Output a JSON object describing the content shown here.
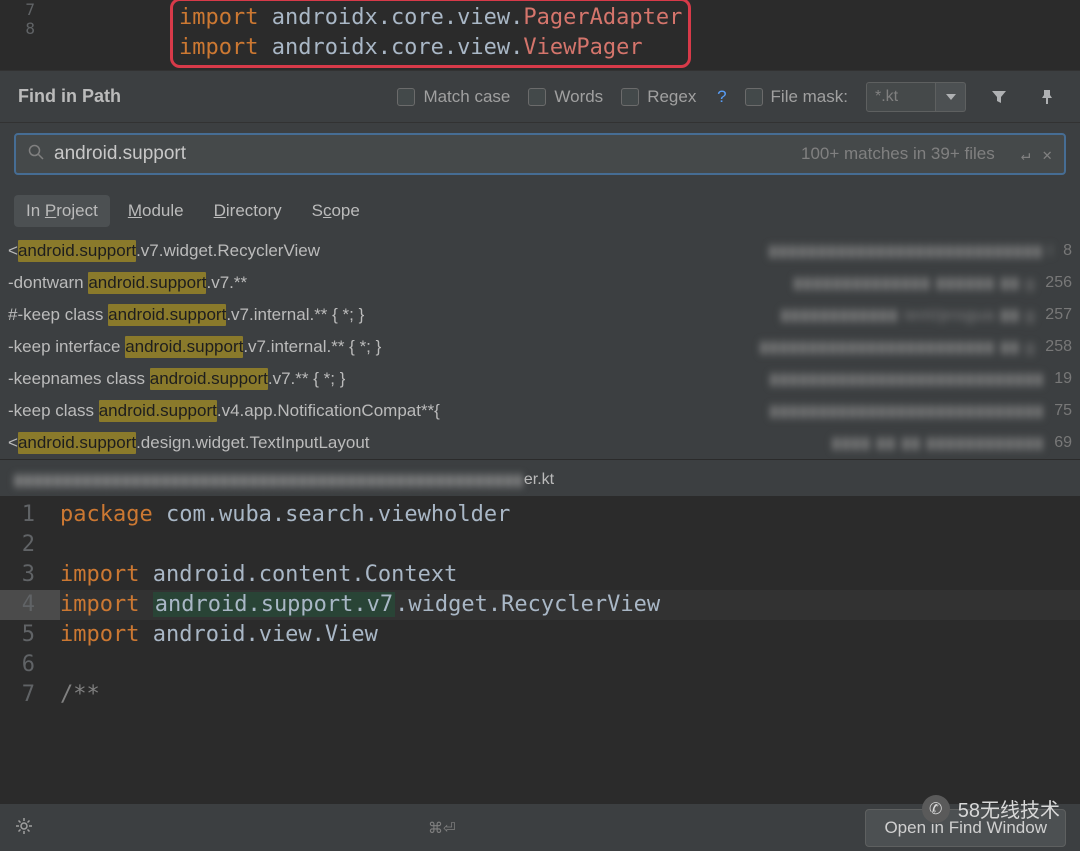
{
  "topCode": [
    {
      "num": "7",
      "kw": "import",
      "pkg": "androidx.core.view.",
      "err": "PagerAdapter"
    },
    {
      "num": "8",
      "kw": "import",
      "pkg": "androidx.core.view.",
      "err": "ViewPager"
    }
  ],
  "find": {
    "title": "Find in Path",
    "matchCase": "Match case",
    "words": "Words",
    "regex": "Regex",
    "regexQ": "?",
    "fileMask": "File mask:",
    "fileMaskVal": "*.kt"
  },
  "search": {
    "value": "android.support",
    "matches": "100+ matches in 39+ files"
  },
  "tabs": {
    "project": "In Project",
    "module": "Module",
    "directory": "Directory",
    "scope": "Scope"
  },
  "results": [
    {
      "pre": "<",
      "hl": "android.support",
      "post": ".v7.widget.RecyclerView",
      "line": "8"
    },
    {
      "pre": "-dontwarn ",
      "hl": "android.support",
      "post": ".v7.**",
      "line": "256"
    },
    {
      "pre": "#-keep class ",
      "hl": "android.support",
      "post": ".v7.internal.** { *; }",
      "line": "257"
    },
    {
      "pre": "-keep interface ",
      "hl": "android.support",
      "post": ".v7.internal.** { *; }",
      "line": "258"
    },
    {
      "pre": "-keepnames class ",
      "hl": "android.support",
      "post": ".v7.** { *; }",
      "line": "19"
    },
    {
      "pre": "-keep class ",
      "hl": "android.support",
      "post": ".v4.app.NotificationCompat**{",
      "line": "75"
    },
    {
      "pre": "<",
      "hl": "android.support",
      "post": ".design.widget.TextInputLayout",
      "line": "69"
    }
  ],
  "resultFiles": [
    "▮▮▮▮▮▮▮▮▮▮▮▮▮▮▮▮▮▮▮▮▮▮▮▮▮▮▮▮ l",
    "▮▮▮▮▮▮▮▮▮▮▮▮▮▮ ▮▮▮▮▮▮ ▮▮ g",
    "▮▮▮▮▮▮▮▮▮▮▮▮ ient/progua ▮▮ g",
    "▮▮▮▮▮▮▮▮▮▮▮▮▮▮▮▮▮▮▮▮▮▮▮▮ ▮▮ g",
    "▮▮▮▮▮▮▮▮▮▮▮▮▮▮▮▮▮▮▮▮▮▮▮▮▮▮▮▮",
    "▮▮▮▮▮▮▮▮▮▮▮▮▮▮▮▮▮▮▮▮▮▮▮▮▮▮▮▮",
    "▮▮▮▮ ▮▮ ▮▮ ▮▮▮▮▮▮▮▮▮▮▮▮"
  ],
  "preview": {
    "ext": "er.kt",
    "lines": [
      {
        "num": "1",
        "html": "<span class='kw'>package</span> <span class='pkg'>com.wuba.search.viewholder</span>"
      },
      {
        "num": "2",
        "html": ""
      },
      {
        "num": "3",
        "html": "<span class='kw'>import</span> <span class='pkg'>android.content.Context</span>"
      },
      {
        "num": "4",
        "html": "<span class='kw'>import</span> <span class='green-bg'>android.support.v7</span><span class='pkg'>.widget.RecyclerView</span>",
        "selected": true
      },
      {
        "num": "5",
        "html": "<span class='kw'>import</span> <span class='pkg'>android.view.View</span>"
      },
      {
        "num": "6",
        "html": ""
      },
      {
        "num": "7",
        "html": "<span class='comment'>/**</span>"
      }
    ]
  },
  "openBtn": "Open in Find Window",
  "shortcut": "⌘⏎",
  "watermark": "58无线技术"
}
